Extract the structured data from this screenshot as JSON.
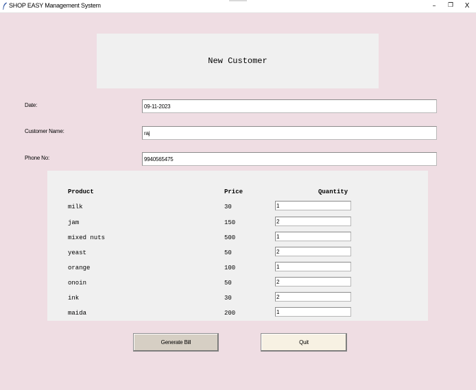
{
  "window": {
    "title": "SHOP EASY Management System",
    "minimize_glyph": "–",
    "restore_glyph": "❐",
    "close_glyph": "X"
  },
  "header": {
    "title": "New Customer"
  },
  "form": {
    "date_label": "Date:",
    "date_value": "09-11-2023",
    "customer_name_label": "Customer Name:",
    "customer_name_value": "raj",
    "phone_label": "Phone No:",
    "phone_value": "9940565475"
  },
  "products": {
    "headers": {
      "product": "Product",
      "price": "Price",
      "quantity": "Quantity"
    },
    "rows": [
      {
        "name": "milk",
        "price": "30",
        "quantity": "1"
      },
      {
        "name": "jam",
        "price": "150",
        "quantity": "2"
      },
      {
        "name": "mixed nuts",
        "price": "500",
        "quantity": "1"
      },
      {
        "name": "yeast",
        "price": "50",
        "quantity": "2"
      },
      {
        "name": "orange",
        "price": "100",
        "quantity": "1"
      },
      {
        "name": "onoin",
        "price": "50",
        "quantity": "2"
      },
      {
        "name": "ink",
        "price": "30",
        "quantity": "2"
      },
      {
        "name": "maida",
        "price": "200",
        "quantity": "1"
      }
    ]
  },
  "buttons": {
    "generate_bill": "Generate Bill",
    "quit": "Quit"
  },
  "colors": {
    "background": "#efdde3",
    "panel": "#f0f0f0",
    "generate_button": "#d6cfc4",
    "quit_button": "#f7f1e3"
  },
  "icons": {
    "app_icon": "feather-icon"
  }
}
